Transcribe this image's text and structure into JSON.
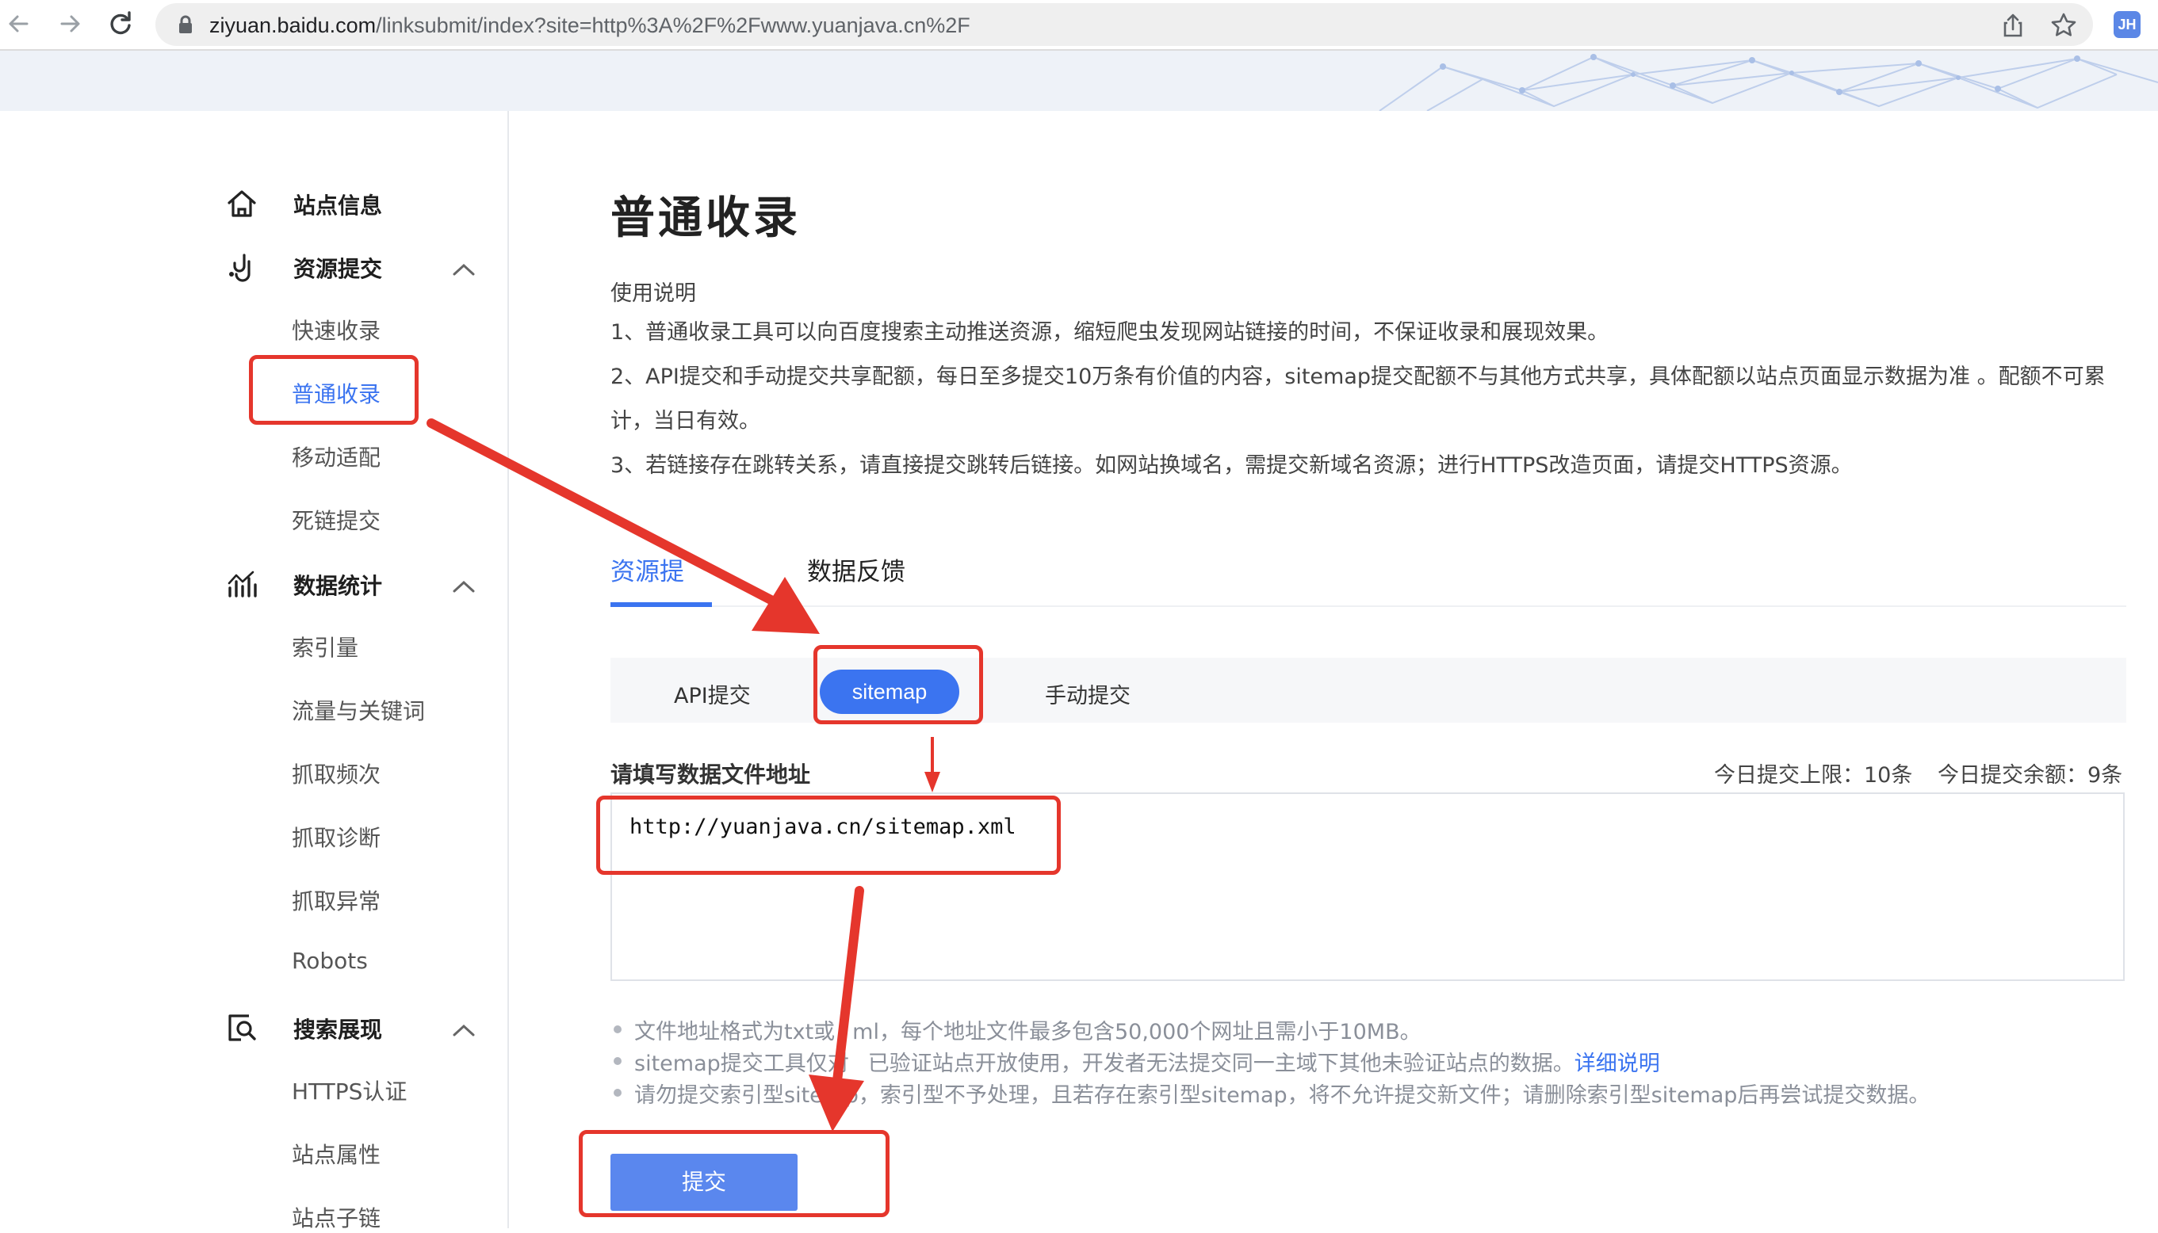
{
  "browser": {
    "url_host": "ziyuan.baidu.com",
    "url_path": "/linksubmit/index?site=http%3A%2F%2Fwww.yuanjava.cn%2F",
    "profile_initials": "JH"
  },
  "sidebar": {
    "groups": [
      {
        "label": "站点信息",
        "icon": "home-icon"
      },
      {
        "label": "资源提交",
        "icon": "link-submit-icon",
        "items": [
          "快速收录",
          "普通收录",
          "移动适配",
          "死链提交"
        ]
      },
      {
        "label": "数据统计",
        "icon": "chart-icon",
        "items": [
          "索引量",
          "流量与关键词",
          "抓取频次",
          "抓取诊断",
          "抓取异常",
          "Robots"
        ]
      },
      {
        "label": "搜索展现",
        "icon": "search-display-icon",
        "items": [
          "HTTPS认证",
          "站点属性",
          "站点子链"
        ]
      }
    ],
    "active_item": "普通收录"
  },
  "main": {
    "title": "普通收录",
    "desc_heading": "使用说明",
    "desc_lines": [
      "1、普通收录工具可以向百度搜索主动推送资源，缩短爬虫发现网站链接的时间，不保证收录和展现效果。",
      "2、API提交和手动提交共享配额，每日至多提交10万条有价值的内容，sitemap提交配额不与其他方式共享，具体配额以站点页面显示数据为准 。配额不可累计，当日有效。",
      "3、若链接存在跳转关系，请直接提交跳转后链接。如网站换域名，需提交新域名资源；进行HTTPS改造页面，请提交HTTPS资源。"
    ],
    "tabs": [
      {
        "label": "资源提交",
        "visible_label": "资源提",
        "active": true
      },
      {
        "label": "数据反馈",
        "active": false
      }
    ],
    "methods": [
      "API提交",
      "sitemap",
      "手动提交"
    ],
    "active_method": "sitemap",
    "field_label": "请填写数据文件地址",
    "quota_limit": "今日提交上限：10条",
    "quota_remaining": "今日提交余额：9条",
    "textarea_value": "http://yuanjava.cn/sitemap.xml",
    "tips": [
      {
        "before": "文件地址格式为txt或",
        "after": "ml，每个地址文件最多包含50,000个网址且需小于10MB。"
      },
      {
        "before": "sitemap提交工具仅对",
        "after": "已验证站点开放使用，开发者无法提交同一主域下其他未验证站点的数据。",
        "link": "详细说明"
      },
      {
        "before": "请勿提交索引型site",
        "after": "p，索引型不予处理，且若存在索引型sitemap，将不允许提交新文件；请删除索引型sitemap后再尝试提交数据。"
      }
    ],
    "submit_label": "提交"
  },
  "colors": {
    "accent": "#3b74f0",
    "annotation": "#e5362c"
  }
}
